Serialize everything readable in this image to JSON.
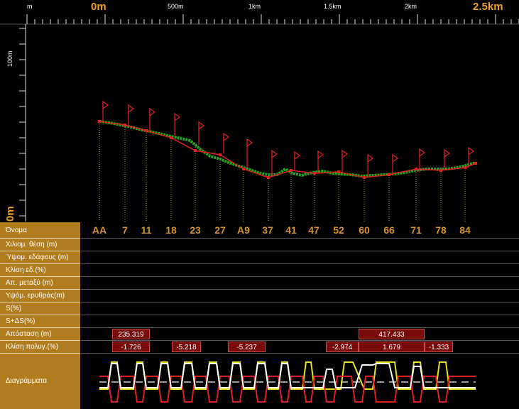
{
  "ruler": {
    "top_labels": [
      {
        "text": "m",
        "major": false
      },
      {
        "text": "0m",
        "major": true
      },
      {
        "text": "500m",
        "major": false
      },
      {
        "text": "1km",
        "major": false
      },
      {
        "text": "1.5km",
        "major": false
      },
      {
        "text": "2km",
        "major": false
      },
      {
        "text": "2.5km",
        "major": true
      }
    ],
    "left_labels": [
      {
        "text": "100m",
        "major": false
      },
      {
        "text": "0m",
        "major": true
      }
    ]
  },
  "colors": {
    "panel_label_bg": "#b07c1e",
    "station_label": "#d4922a",
    "terrain": "#1fa51f",
    "design_line": "#e02020",
    "diagram_yellow": "#e8e020",
    "diagram_red": "#e02020",
    "value_box": "#7a0b0b"
  },
  "stations": {
    "names": [
      "AA",
      "7",
      "11",
      "18",
      "23",
      "27",
      "A9",
      "37",
      "41",
      "47",
      "52",
      "60",
      "66",
      "71",
      "78",
      "84"
    ]
  },
  "table": {
    "rows": [
      "Όνομα",
      "Χιλιομ. θέση (m)",
      "Ύψομ. εδάφους (m)",
      "Κλίση εδ.(%)",
      "Απ. μεταξύ (m)",
      "Υψόμ. ερυθράς(m)",
      "S(%)",
      "S+ΔS(%)",
      "Απόσταση (m)",
      "Κλίση πολυγ.(%)",
      "Διαγράμματα"
    ],
    "distance_values": [
      "235.319",
      "417.433"
    ],
    "slope_values": [
      "-1.726",
      "-5.218",
      "-5.237",
      "-2.974",
      "1.679",
      "-1.333"
    ]
  }
}
